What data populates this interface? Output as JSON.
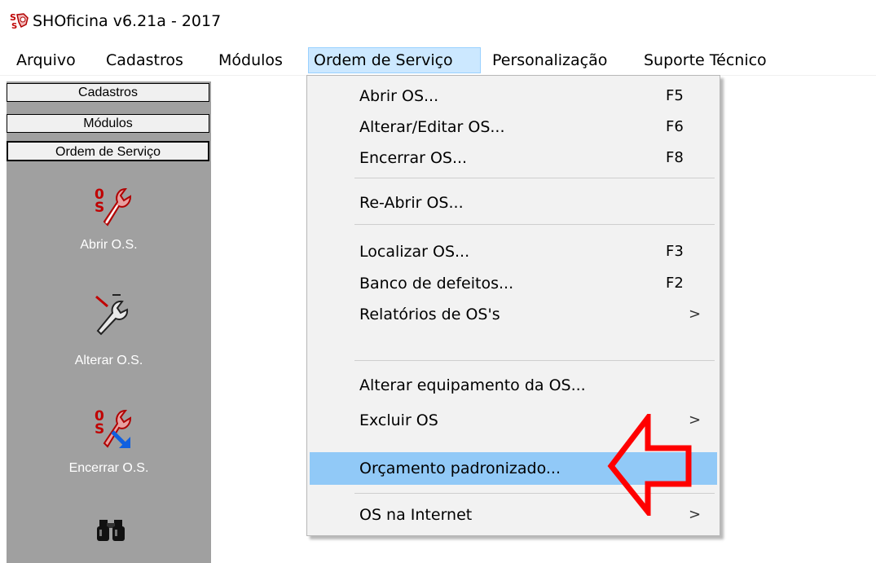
{
  "window": {
    "title": "SHOficina v6.21a - 2017"
  },
  "menubar": {
    "items": [
      {
        "label": "Arquivo"
      },
      {
        "label": "Cadastros"
      },
      {
        "label": "Módulos"
      },
      {
        "label": "Ordem de Serviço",
        "active": true
      },
      {
        "label": "Personalização"
      },
      {
        "label": "Suporte Técnico"
      }
    ]
  },
  "sidebar": {
    "buttons": [
      {
        "label": "Cadastros"
      },
      {
        "label": "Módulos"
      },
      {
        "label": "Ordem de Serviço"
      }
    ],
    "tools": [
      {
        "label": "Abrir O.S.",
        "icon": "wrench-os-icon"
      },
      {
        "label": "Alterar O.S.",
        "icon": "wrench-edit-icon"
      },
      {
        "label": "Encerrar O.S.",
        "icon": "wrench-close-icon"
      },
      {
        "label": "",
        "icon": "binoculars-icon"
      }
    ]
  },
  "dropdown": {
    "items": [
      {
        "label": "Abrir OS...",
        "shortcut": "F5"
      },
      {
        "label": "Alterar/Editar OS...",
        "shortcut": "F6"
      },
      {
        "label": "Encerrar OS...",
        "shortcut": "F8"
      },
      {
        "label": "Re-Abrir OS...",
        "shortcut": ""
      },
      {
        "label": "Localizar OS...",
        "shortcut": "F3"
      },
      {
        "label": "Banco de defeitos...",
        "shortcut": "F2"
      },
      {
        "label": "Relatórios de OS's",
        "submenu": ">"
      },
      {
        "label": "Alterar equipamento da OS...",
        "shortcut": ""
      },
      {
        "label": "Excluir OS",
        "submenu": ">"
      },
      {
        "label": "Orçamento padronizado...",
        "highlighted": true
      },
      {
        "label": "OS na Internet",
        "submenu": ">"
      }
    ]
  },
  "colors": {
    "menu_highlight": "#91c9f7",
    "menubar_active": "#cce8ff",
    "sidebar_bg": "#a0a0a0",
    "annotation_arrow": "#ff0000"
  }
}
